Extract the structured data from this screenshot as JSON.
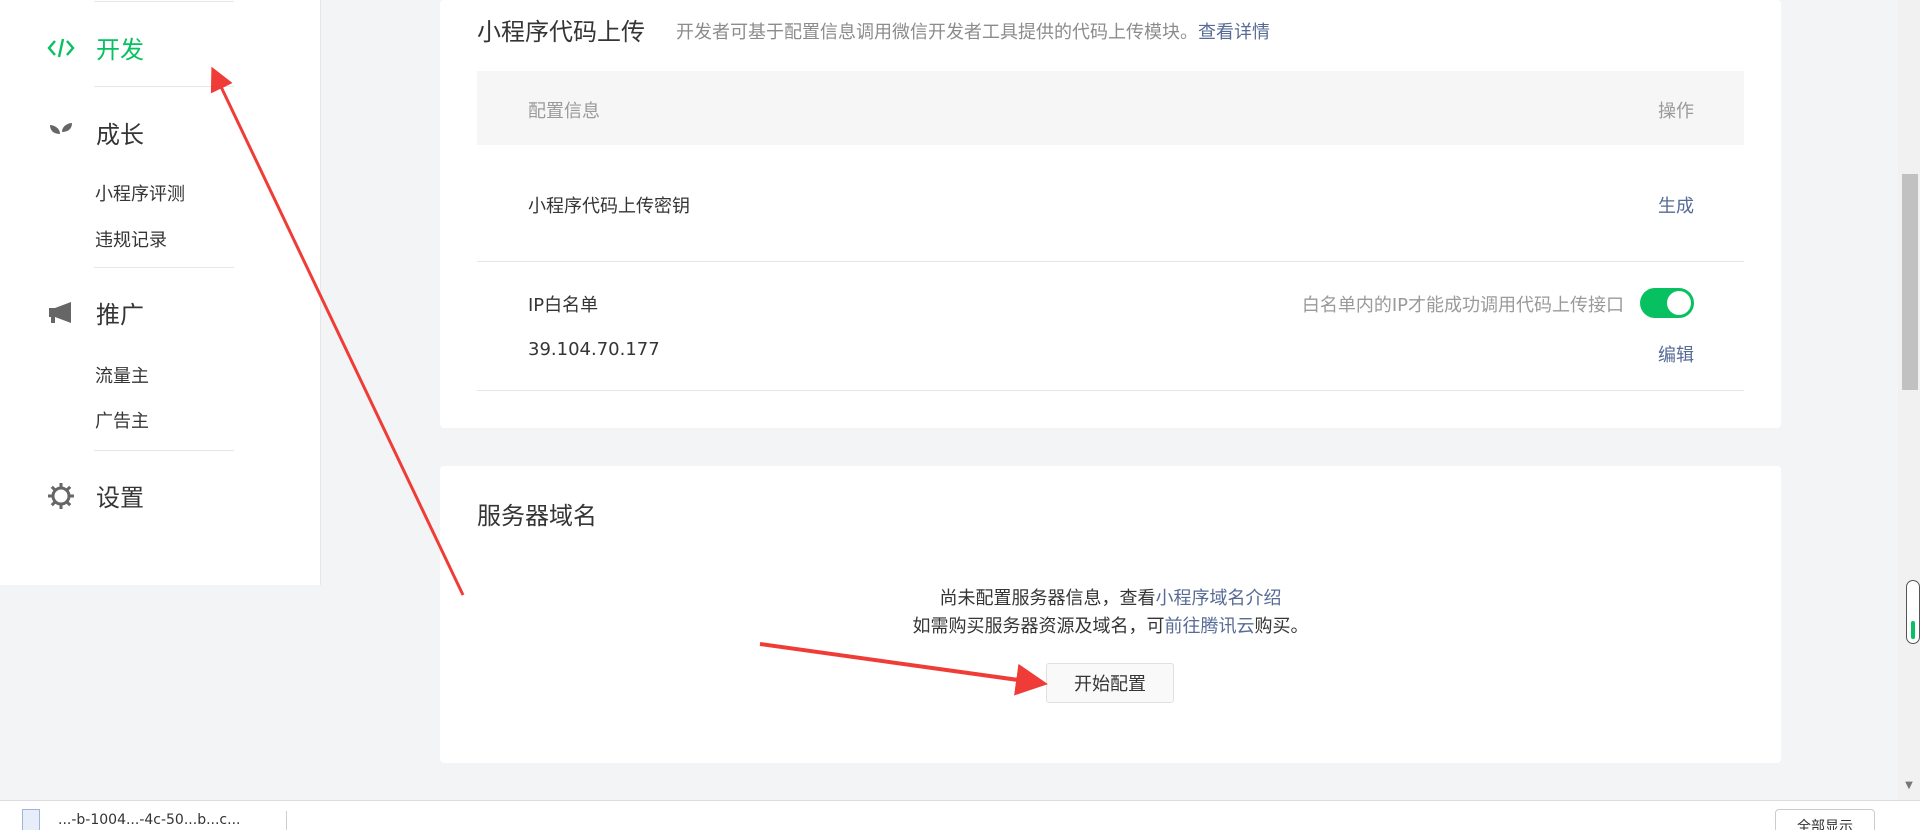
{
  "sidebar": {
    "dev": {
      "label": "开发",
      "icon": "code-icon"
    },
    "growth": {
      "label": "成长",
      "icon": "sprout-icon",
      "items": [
        {
          "label": "小程序评测"
        },
        {
          "label": "违规记录"
        }
      ]
    },
    "promotion": {
      "label": "推广",
      "icon": "megaphone-icon",
      "items": [
        {
          "label": "流量主"
        },
        {
          "label": "广告主"
        }
      ]
    },
    "settings": {
      "label": "设置",
      "icon": "gear-icon"
    }
  },
  "upload_section": {
    "title": "小程序代码上传",
    "desc": "开发者可基于配置信息调用微信开发者工具提供的代码上传模块。",
    "desc_link": "查看详情",
    "table": {
      "col_config": "配置信息",
      "col_action": "操作"
    },
    "key_row": {
      "label": "小程序代码上传密钥",
      "action": "生成"
    },
    "ip_row": {
      "label": "IP白名单",
      "value": "39.104.70.177",
      "hint": "白名单内的IP才能成功调用代码上传接口",
      "toggle_on": true,
      "action": "编辑"
    }
  },
  "server_section": {
    "title": "服务器域名",
    "line1_prefix": "尚未配置服务器信息，查看",
    "line1_link": "小程序域名介绍",
    "line2_prefix": "如需购买服务器资源及域名，可",
    "line2_link": "前往腾讯云",
    "line2_suffix": "购买。",
    "button": "开始配置"
  },
  "download_bar": {
    "file_name": "...-b-1004...-4c-50...b...c...",
    "show_all": "全部显示"
  },
  "colors": {
    "accent": "#07c160",
    "link": "#576b95",
    "arrow": "#f03c36"
  }
}
